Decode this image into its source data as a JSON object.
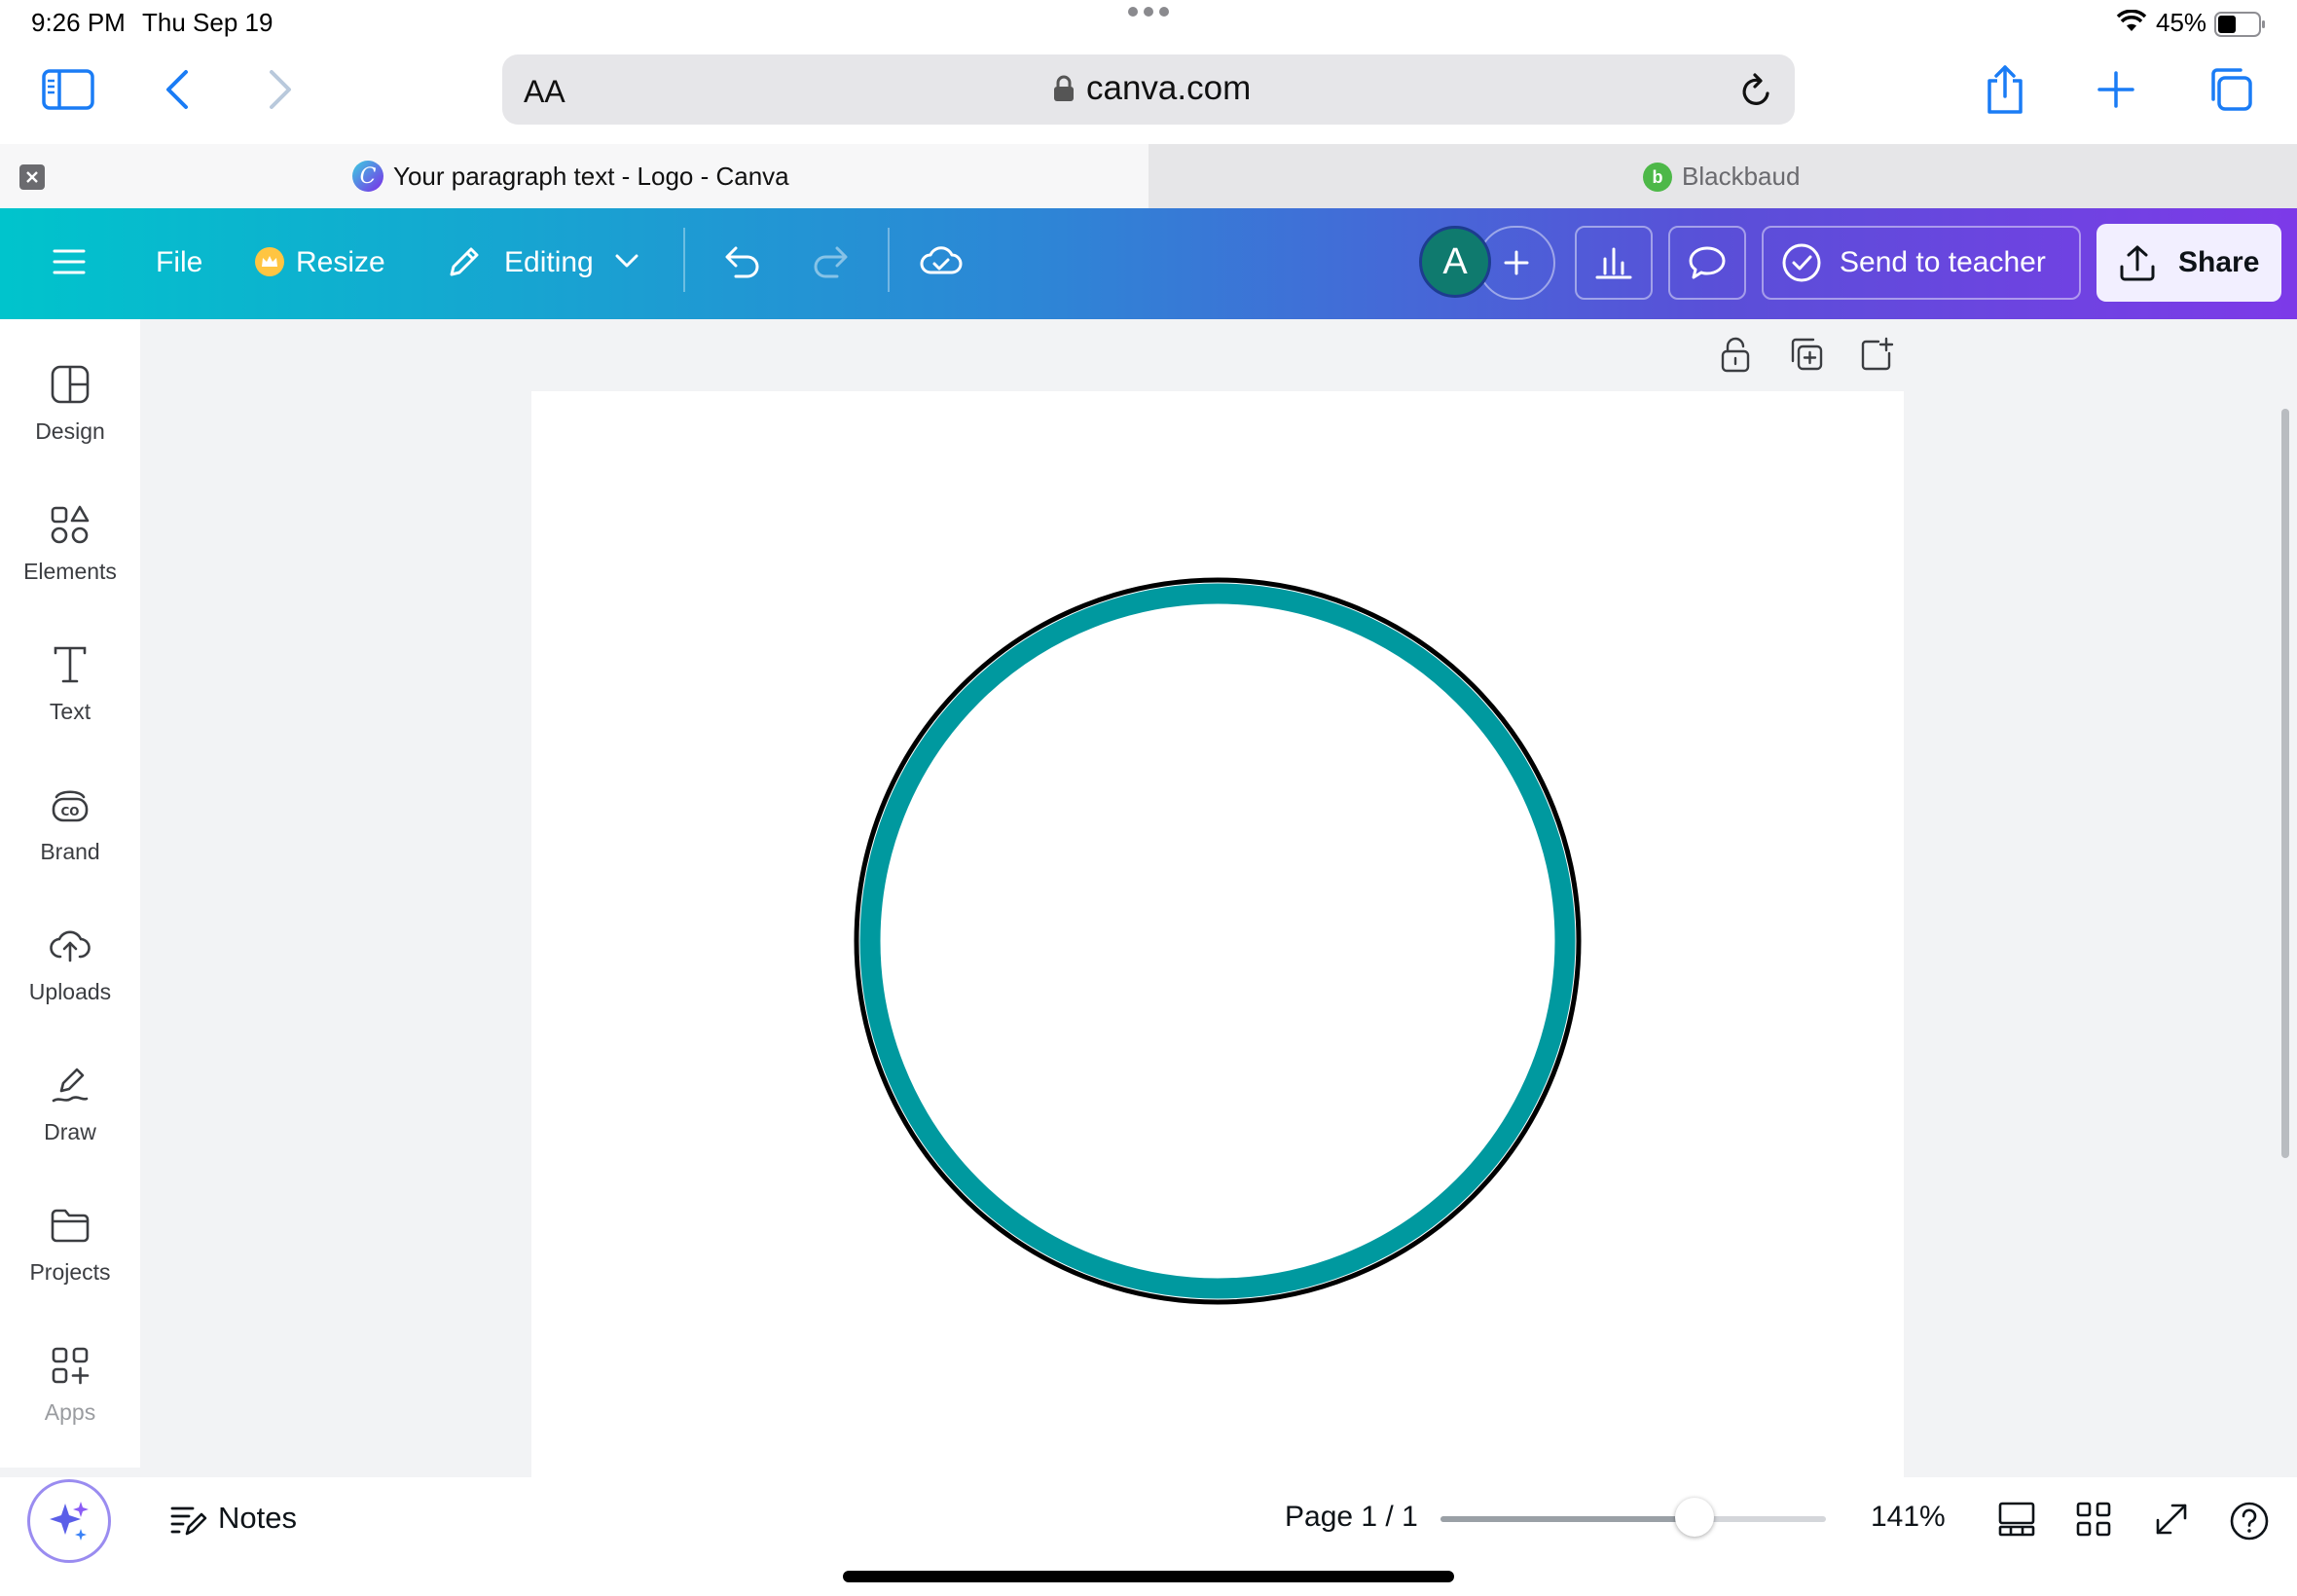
{
  "status_bar": {
    "time": "9:26 PM",
    "date": "Thu Sep 19",
    "battery": "45%",
    "battery_level": 0.45
  },
  "browser": {
    "url_aa": "AA",
    "url": "canva.com",
    "tabs": [
      {
        "title": "Your paragraph text - Logo - Canva",
        "active": true
      },
      {
        "title": "Blackbaud",
        "active": false
      }
    ]
  },
  "header": {
    "file_label": "File",
    "resize_label": "Resize",
    "editing_label": "Editing",
    "avatar_initial": "A",
    "send_teacher_label": "Send to teacher",
    "share_label": "Share"
  },
  "sidebar": {
    "items": [
      {
        "label": "Design",
        "icon": "design-icon"
      },
      {
        "label": "Elements",
        "icon": "elements-icon"
      },
      {
        "label": "Text",
        "icon": "text-icon"
      },
      {
        "label": "Brand",
        "icon": "brand-icon"
      },
      {
        "label": "Uploads",
        "icon": "uploads-icon"
      },
      {
        "label": "Draw",
        "icon": "draw-icon"
      },
      {
        "label": "Projects",
        "icon": "projects-icon"
      },
      {
        "label": "Apps",
        "icon": "apps-icon"
      }
    ]
  },
  "canvas": {
    "ring_color": "#00999f",
    "ring_outline_color": "#000000"
  },
  "bottom_bar": {
    "notes_label": "Notes",
    "page_indicator": "Page 1 / 1",
    "zoom_label": "141%",
    "zoom_slider_fraction": 0.66
  },
  "colors": {
    "header_gradient_start": "#00c4cc",
    "header_gradient_end": "#7d3ae8",
    "safari_blue": "#1a7cf5"
  }
}
